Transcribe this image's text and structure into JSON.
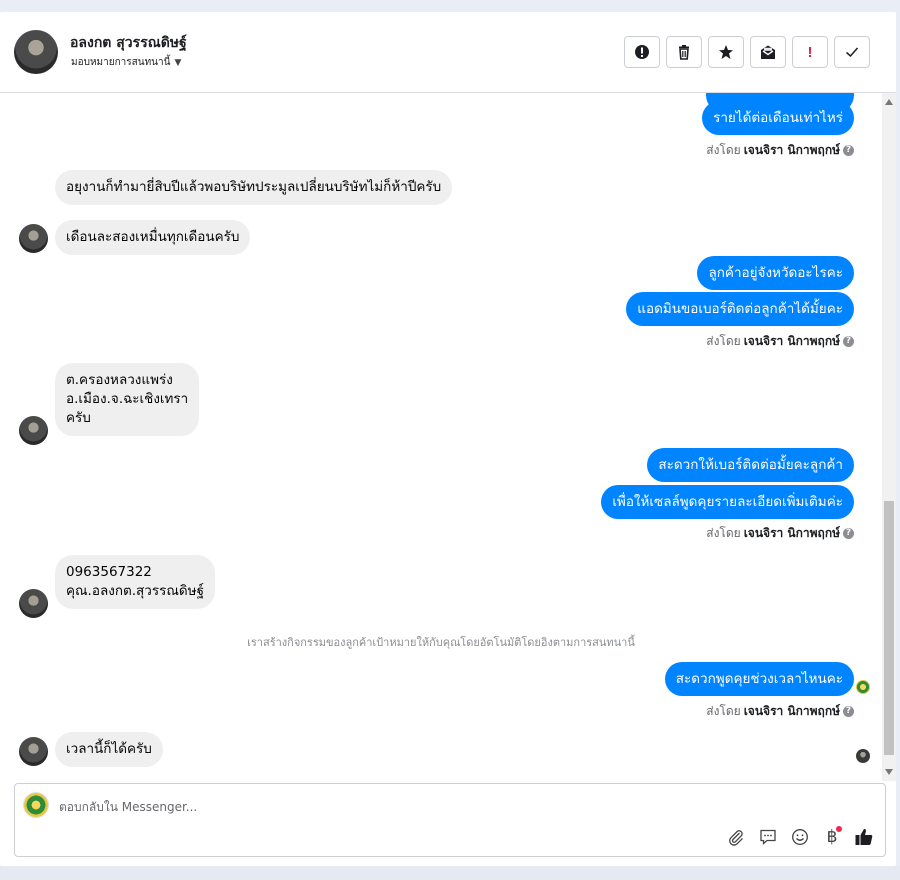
{
  "header": {
    "contact_name": "อลงกต สุวรรณดิษฐ์",
    "assign_label": "มอบหมายการสนทนานี้"
  },
  "actions": [
    {
      "name": "spam-icon"
    },
    {
      "name": "trash-icon"
    },
    {
      "name": "star-icon"
    },
    {
      "name": "mark-unread-icon"
    },
    {
      "name": "follow-up-icon",
      "text": "!"
    },
    {
      "name": "done-check-icon"
    }
  ],
  "thread": {
    "out_top_partial": "",
    "out1": "รายได้ต่อเดือนเท่าไหร่",
    "sent_by_prefix": "ส่งโดย",
    "agent_name": "เจนจิรา นิกาพฤกษ์",
    "help_mark": "?",
    "in1": "อยุงานก็ทำมายี่สิบปีแล้วพอบริษัทประมูลเปลี่ยนบริษัทไม่ก็ห้าปีครับ",
    "in2": "เดือนละสองเหมื่นทุกเดือนครับ",
    "out2": "ลูกค้าอยู่จังหวัดอะไรคะ",
    "out3": "แอดมินขอเบอร์ติดต่อลูกค้าได้มั้ยคะ",
    "in3_line1": "ต.ครองหลวงแพร่ง",
    "in3_line2": "อ.เมือง.จ.ฉะเชิงเทรา",
    "in3_line3": "ครับ",
    "out4": "สะดวกให้เบอร์ติดต่อมั้ยคะลูกค้า",
    "out5": "เพื่อให้เซลล์พูดคุยรายละเอียดเพิ่มเติมค่ะ",
    "in4_line1": "0963567322",
    "in4_line2": "คุณ.อลงกต.สุวรรณดิษฐ์",
    "system_note": "เราสร้างกิจกรรมของลูกค้าเป้าหมายให้กับคุณโดยอัตโนมัติโดยอิงตามการสนทนานี้",
    "out6": "สะดวกพูดคุยช่วงเวลาไหนคะ",
    "in5": "เวลานี้ก็ได้ครับ"
  },
  "composer": {
    "placeholder": "ตอบกลับใน Messenger...",
    "baht_symbol": "฿"
  },
  "colors": {
    "outgoing_bubble": "#0084ff",
    "incoming_bubble": "#efefef",
    "follow_up_red": "#e41e3f"
  }
}
